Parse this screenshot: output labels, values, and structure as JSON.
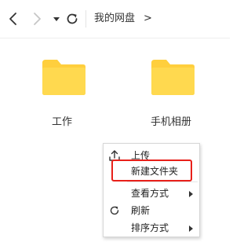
{
  "breadcrumb": {
    "current": "我的网盘",
    "separator": ">"
  },
  "folders": [
    {
      "name": "工作",
      "color": "#ffd64a"
    },
    {
      "name": "手机相册",
      "color": "#ffd64a"
    }
  ],
  "context_menu": {
    "items": {
      "upload": {
        "label": "上传",
        "icon": "upload-icon"
      },
      "new_folder": {
        "label": "新建文件夹",
        "highlighted": true
      },
      "view_mode": {
        "label": "查看方式",
        "has_submenu": true
      },
      "refresh": {
        "label": "刷新",
        "icon": "refresh-icon"
      },
      "sort": {
        "label": "排序方式",
        "has_submenu": true
      }
    },
    "highlight_color": "#e8201a"
  }
}
